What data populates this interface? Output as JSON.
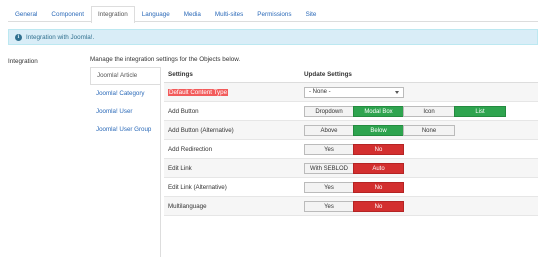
{
  "tabs": [
    {
      "label": "General"
    },
    {
      "label": "Component"
    },
    {
      "label": "Integration",
      "active": true
    },
    {
      "label": "Language"
    },
    {
      "label": "Media"
    },
    {
      "label": "Multi-sites"
    },
    {
      "label": "Permissions"
    },
    {
      "label": "Site"
    }
  ],
  "alert": {
    "icon": "info-icon",
    "text": "Integration with Joomla!."
  },
  "section_label": "Integration",
  "description": "Manage the integration settings for the Objects below.",
  "subnav": [
    {
      "label": "Joomla! Article",
      "active": true
    },
    {
      "label": "Joomla! Category"
    },
    {
      "label": "Joomla! User"
    },
    {
      "label": "Joomla! User Group"
    }
  ],
  "table": {
    "headers": {
      "settings": "Settings",
      "update": "Update Settings"
    },
    "rows": [
      {
        "label": "Default Content Type",
        "select": "- None -"
      },
      {
        "label": "Add Button",
        "options": [
          "Dropdown",
          "Modal Box",
          "Icon",
          "List"
        ],
        "selected": [
          "Modal Box",
          "List"
        ]
      },
      {
        "label": "Add Button (Alternative)",
        "options": [
          "Above",
          "Below",
          "None"
        ],
        "selected": [
          "Below"
        ]
      },
      {
        "label": "Add Redirection",
        "options": [
          "Yes",
          "No"
        ],
        "selected": [
          "No"
        ]
      },
      {
        "label": "Edit Link",
        "options": [
          "With SEBLOD",
          "Auto"
        ],
        "selected": [
          "Auto"
        ]
      },
      {
        "label": "Edit Link (Alternative)",
        "options": [
          "Yes",
          "No"
        ],
        "selected": [
          "No"
        ]
      },
      {
        "label": "Multilanguage",
        "options": [
          "Yes",
          "No"
        ],
        "selected": [
          "No"
        ]
      }
    ]
  },
  "colors": {
    "link": "#2a69b8",
    "selected_green": "#2ea44f",
    "selected_red": "#d32f2f",
    "alert_bg": "#d9edf7",
    "highlight": "#f25b5b"
  }
}
